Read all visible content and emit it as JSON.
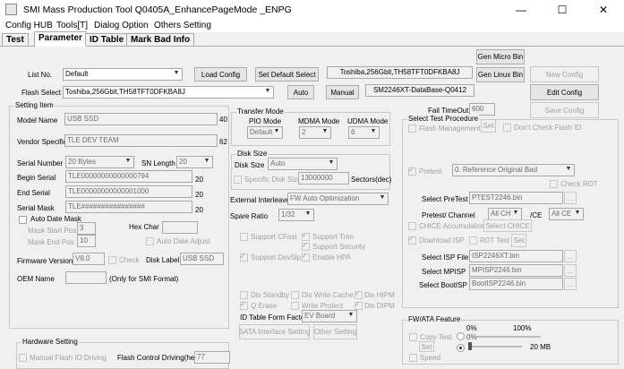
{
  "window": {
    "title": "SMI Mass Production Tool Q0405A_EnhancePageMode    _ENPG",
    "min": "—",
    "max": "☐",
    "close": "✕"
  },
  "menu": [
    "Config HUB",
    "Tools[T]",
    "Dialog Option",
    "Others Setting"
  ],
  "tabs": [
    "Test",
    "Parameter",
    "ID Table",
    "Mark Bad Info"
  ],
  "top": {
    "list_no_label": "List No.",
    "list_no_value": "Default",
    "load_config": "Load Config",
    "set_default_select": "Set Default Select",
    "flash_info": "Toshiba,256Gbit,TH58TFT0DFKBA8J",
    "flash_select_label": "Flash Select",
    "flash_select_value": "Toshiba,256Gbit,TH58TFT0DFKBA8J",
    "auto": "Auto",
    "manual": "Manual",
    "database": "SM2246XT-DataBase-Q0412",
    "gen_micro_bin": "Gen Micro Bin",
    "gen_linux_bin": "Gen Linux Bin",
    "new_config": "New Config",
    "edit_config": "Edit Config",
    "save_config": "Save Config",
    "fail_timeout_label": "Fail TimeOut",
    "fail_timeout_value": "600"
  },
  "setting": {
    "title": "Setting Item",
    "model_name_label": "Model Name",
    "model_name": "USB SSD",
    "model_name_len": "40",
    "vendor_label": "Vendor Specific",
    "vendor": "TLE DEV TEAM",
    "vendor_len": "62",
    "serial_number_label": "Serial Number",
    "serial_number": "20 Bytes",
    "sn_length_label": "SN Length",
    "sn_length": "20",
    "begin_serial_label": "Begin Serial",
    "begin_serial": "TLE00000000000000794",
    "begin_serial_len": "20",
    "end_serial_label": "End Serial",
    "end_serial": "TLE00000000000001000",
    "end_serial_len": "20",
    "serial_mask_label": "Serial Mask",
    "serial_mask": "TLE################",
    "serial_mask_len": "20",
    "auto_date_mask": "Auto Date Mask",
    "mask_start_label": "Mask Start Pos",
    "mask_start": "3",
    "mask_end_label": "Mask End Pos",
    "mask_end": "10",
    "hex_char_label": "Hex Char",
    "auto_date_adjust": "Auto Date Adjust",
    "firmware_label": "Firmware Version",
    "firmware": "V8.0",
    "check": "Check",
    "disk_label_label": "Disk Label",
    "disk_label": "USB SSD",
    "oem_label": "OEM Name",
    "oem_note": "(Only for SMI Format)"
  },
  "transfer": {
    "title": "Transfer Mode",
    "pio_label": "PIO Mode",
    "pio": "Default",
    "mdma_label": "MDMA Mode",
    "mdma": "2",
    "udma_label": "UDMA Mode",
    "udma": "6"
  },
  "disk_size": {
    "title": "Disk Size",
    "label": "Disk Size",
    "value": "Auto",
    "specific_label": "Specific Disk Size",
    "specific_value": "13000000",
    "unit": "Sectors(dec)"
  },
  "external": {
    "interleave_label": "External Interleave",
    "interleave": "FW Auto Optimization",
    "spare_label": "Spare Ratio",
    "spare": "1/32"
  },
  "features": {
    "support_cfast": "Support CFast",
    "support_trim": "Support Trim",
    "support_security": "Support Security",
    "support_devslp": "Support DevSlp",
    "enable_hpa": "Enable HPA",
    "dis_standby": "Dis Standby",
    "dis_write_cache": "Dis Write Cache",
    "dis_hipm": "Dis HIPM",
    "q_erase": "Q Erase",
    "write_protect": "Write Protect",
    "dis_dipm": "Dis DIPM",
    "id_form_factor_label": "ID Table Form Factor",
    "id_form_factor": "EV Board",
    "sata_interface": "SATA Interface Setting",
    "other_setting": "Other Setting"
  },
  "select_test": {
    "title": "Select Test Procedure",
    "flash_management": "Flash Management",
    "set": "Set",
    "dont_check_flash_id": "Don't Check Flash ID",
    "pretest": "Pretest",
    "pretest_value": "0. Reference Original Bad",
    "check_rdt": "Check RDT",
    "select_pretest_label": "Select PreTest",
    "select_pretest": "PTEST2246.bin",
    "pretest_channel_label": "Pretest/ Channel",
    "channel": "All CH",
    "ce_label": "/CE",
    "ce": "All CE",
    "chice_accumulation": "CHICE Accumulation",
    "select_chice": "Select CHICE",
    "download_isp": "Download ISP",
    "rdt_test": "RDT Test",
    "rdt_set": "Set",
    "select_isp_label": "Select ISP File",
    "isp_file": "ISP2246XT.bin",
    "select_mpisp_label": "Select MPISP",
    "mpisp": "MPISP2246.bin",
    "select_bootisp_label": "Select BootISP",
    "bootisp": "BootISP2246.bin",
    "browse": "..."
  },
  "fwata": {
    "title": "FW/ATA Feature",
    "pct_0": "0%",
    "pct_100": "100%",
    "copy_test": "Copy Test",
    "set": "Set",
    "zero_pct": "0%",
    "mb": "20 MB",
    "speed": "Speed"
  },
  "hardware": {
    "title": "Hardware Setting",
    "manual_flash_io": "Manual Flash IO Driving",
    "flash_control_label": "Flash Control Driving(hex)",
    "flash_control": "77"
  }
}
